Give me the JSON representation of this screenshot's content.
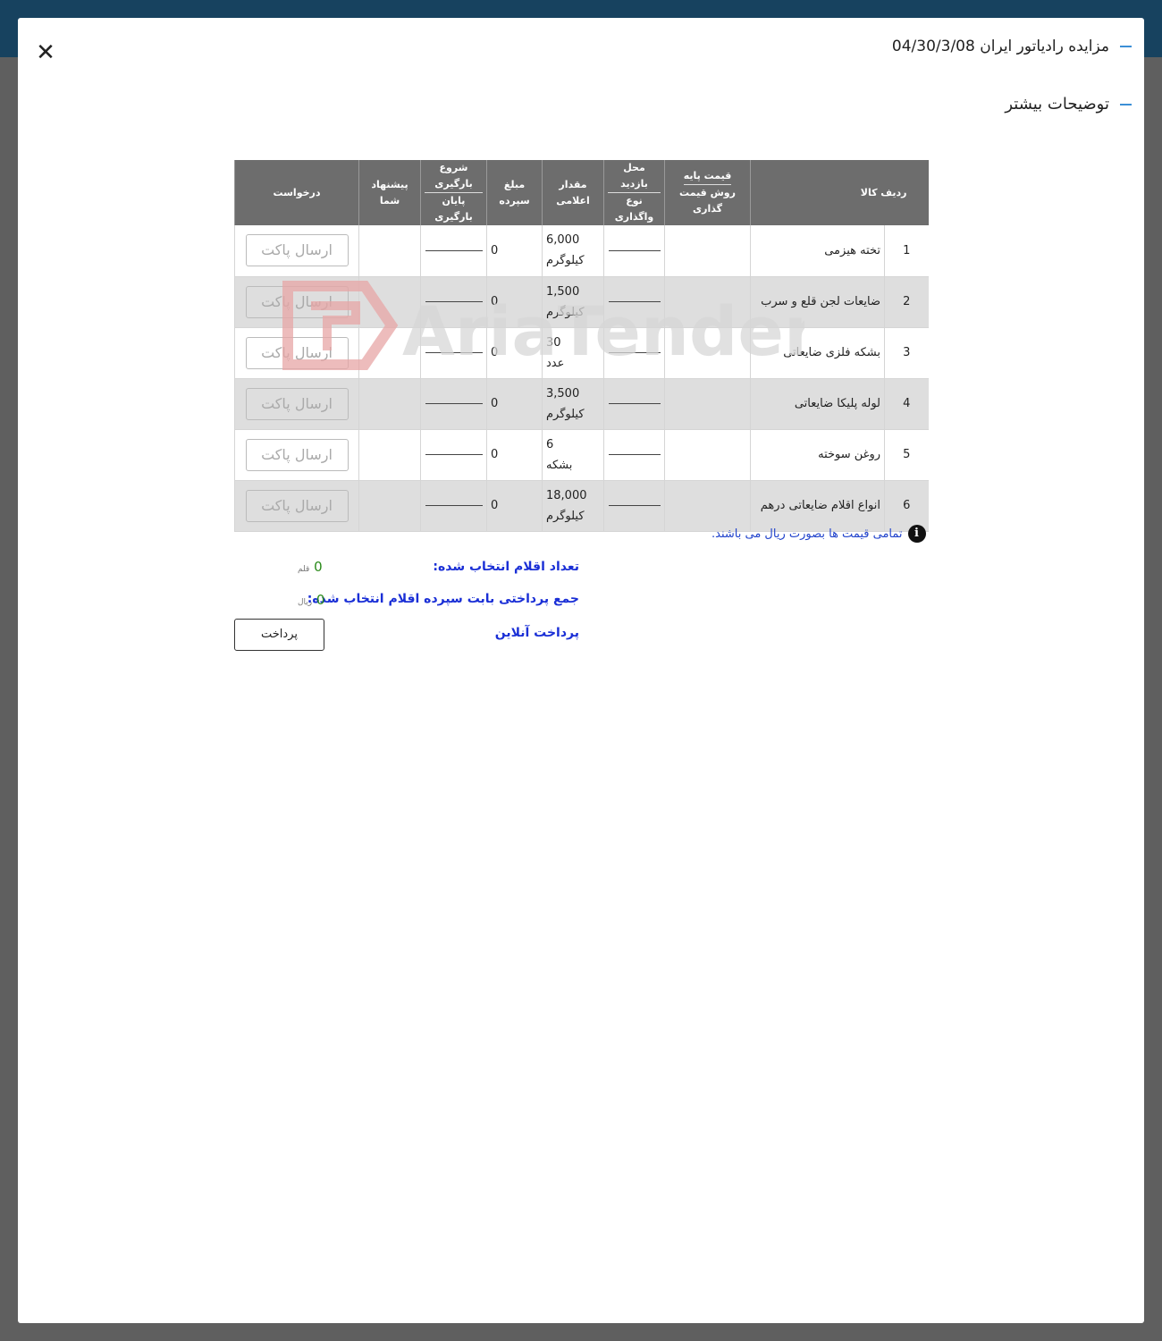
{
  "modal": {
    "title": "مزایده رادیاتور ایران 04/30/3/08",
    "more_label": "توضیحات بیشتر",
    "close_label": "✕"
  },
  "watermark_text": "AriaTender.net",
  "table": {
    "headers": {
      "row_item": "ردیف کالا",
      "base_price": "قیمت پایه",
      "pricing_method": "روش قیمت گذاری",
      "visit_place": "محل بازدید",
      "transfer_type": "نوع واگذاری",
      "announced_qty": "مقدار اعلامی",
      "deposit": "مبلغ سپرده",
      "load_start": "شروع بارگیری",
      "load_end": "پایان بارگیری",
      "your_offer": "پیشنهاد شما",
      "request": "درخواست"
    },
    "rows": [
      {
        "num": "1",
        "name": "تخته هیزمی",
        "qty": "6,000",
        "unit": "کیلوگرم",
        "deposit": "0",
        "button": "ارسال پاکت"
      },
      {
        "num": "2",
        "name": "ضایعات لجن قلع و سرب",
        "qty": "1,500",
        "unit": "کیلوگرم",
        "deposit": "0",
        "button": "ارسال پاکت"
      },
      {
        "num": "3",
        "name": "بشکه فلزی ضایعاتی",
        "qty": "30",
        "unit": "عدد",
        "deposit": "0",
        "button": "ارسال پاکت"
      },
      {
        "num": "4",
        "name": "لوله پلیکا ضایعاتی",
        "qty": "3,500",
        "unit": "کیلوگرم",
        "deposit": "0",
        "button": "ارسال پاکت"
      },
      {
        "num": "5",
        "name": "روغن سوخته",
        "qty": "6",
        "unit": "بشکه",
        "deposit": "0",
        "button": "ارسال پاکت"
      },
      {
        "num": "6",
        "name": "انواع اقلام ضایعاتی درهم",
        "qty": "18,000",
        "unit": "کیلوگرم",
        "deposit": "0",
        "button": "ارسال پاکت"
      }
    ]
  },
  "note": "تمامی قیمت ها بصورت ریال می باشند.",
  "summary": {
    "selected_count_label": "تعداد اقلام انتخاب شده:",
    "selected_count_value": "0",
    "selected_count_unit": "قلم",
    "total_label": "جمع پرداختی بابت سپرده اقلام انتخاب شده:",
    "total_value": "0",
    "total_unit": "ریال",
    "online_pay_label": "پرداخت آنلاین",
    "pay_button": "پرداخت"
  },
  "colors": {
    "topbar": "#17425f",
    "header_bg": "#6d6d6d",
    "alt_row": "#dedede",
    "summary_label": "#1a2fd6",
    "summary_value": "#2a8a1a",
    "accent_dash": "#3b8fd6"
  }
}
